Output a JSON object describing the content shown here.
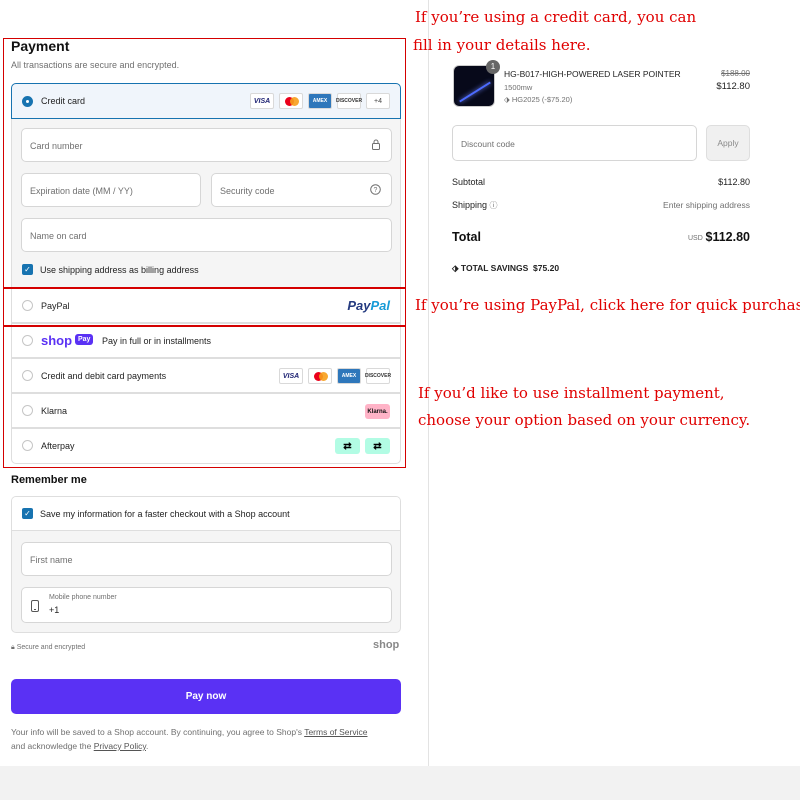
{
  "payment": {
    "title": "Payment",
    "subtitle": "All transactions are secure and encrypted.",
    "credit_card": {
      "label": "Credit card",
      "logos": [
        "VISA",
        "",
        "AMEX",
        "DISCOVER",
        "+4"
      ],
      "card_number_placeholder": "Card number",
      "expiration_placeholder": "Expiration date (MM / YY)",
      "security_code_placeholder": "Security code",
      "name_placeholder": "Name on card",
      "billing_checkbox_label": "Use shipping address as billing address"
    },
    "paypal": {
      "label": "PayPal",
      "logo_a": "Pay",
      "logo_b": "Pal"
    },
    "shop_pay": {
      "logo_word": "shop",
      "logo_badge": "Pay",
      "label": "Pay in full or in installments"
    },
    "debit": {
      "label": "Credit and debit card payments",
      "logos": [
        "VISA",
        "",
        "AMEX",
        "DISCOVER"
      ]
    },
    "klarna": {
      "label": "Klarna",
      "logo": "Klarna."
    },
    "afterpay": {
      "label": "Afterpay"
    }
  },
  "remember": {
    "title": "Remember me",
    "save_label": "Save my information for a faster checkout with a Shop account",
    "first_name_placeholder": "First name",
    "phone_label": "Mobile phone number",
    "phone_value": "+1"
  },
  "footer": {
    "secure_text": "Secure and encrypted",
    "shop_logo": "shop",
    "pay_now": "Pay now",
    "legal_1": "Your info will be saved to a Shop account. By continuing, you agree to Shop's ",
    "terms": "Terms of Service",
    "legal_2": "and acknowledge the ",
    "privacy": "Privacy Policy",
    "legal_3": "."
  },
  "summary": {
    "qty": "1",
    "product_name": "HG-B017-HIGH-POWERED LASER POINTER",
    "variant": "1500mw",
    "discount_tag": "HG2025 (-$75.20)",
    "old_price": "$188.00",
    "new_price": "$112.80",
    "discount_placeholder": "Discount code",
    "apply": "Apply",
    "subtotal_label": "Subtotal",
    "subtotal_value": "$112.80",
    "shipping_label": "Shipping",
    "shipping_value": "Enter shipping address",
    "total_label": "Total",
    "currency": "USD",
    "total_value": "$112.80",
    "savings_label": "TOTAL SAVINGS",
    "savings_value": "$75.20"
  },
  "annotations": {
    "credit_line1": "If you’re using a credit card, you can",
    "credit_line2": "fill in your details here.",
    "paypal": "If you’re using PayPal, click here for quick purchase.",
    "install_line1": "If you’d like to use installment payment,",
    "install_line2": "choose your option based on your currency."
  },
  "colors": {
    "accent": "#1773b0",
    "shop_purple": "#5a31f4",
    "annotation_red": "#e00000"
  }
}
